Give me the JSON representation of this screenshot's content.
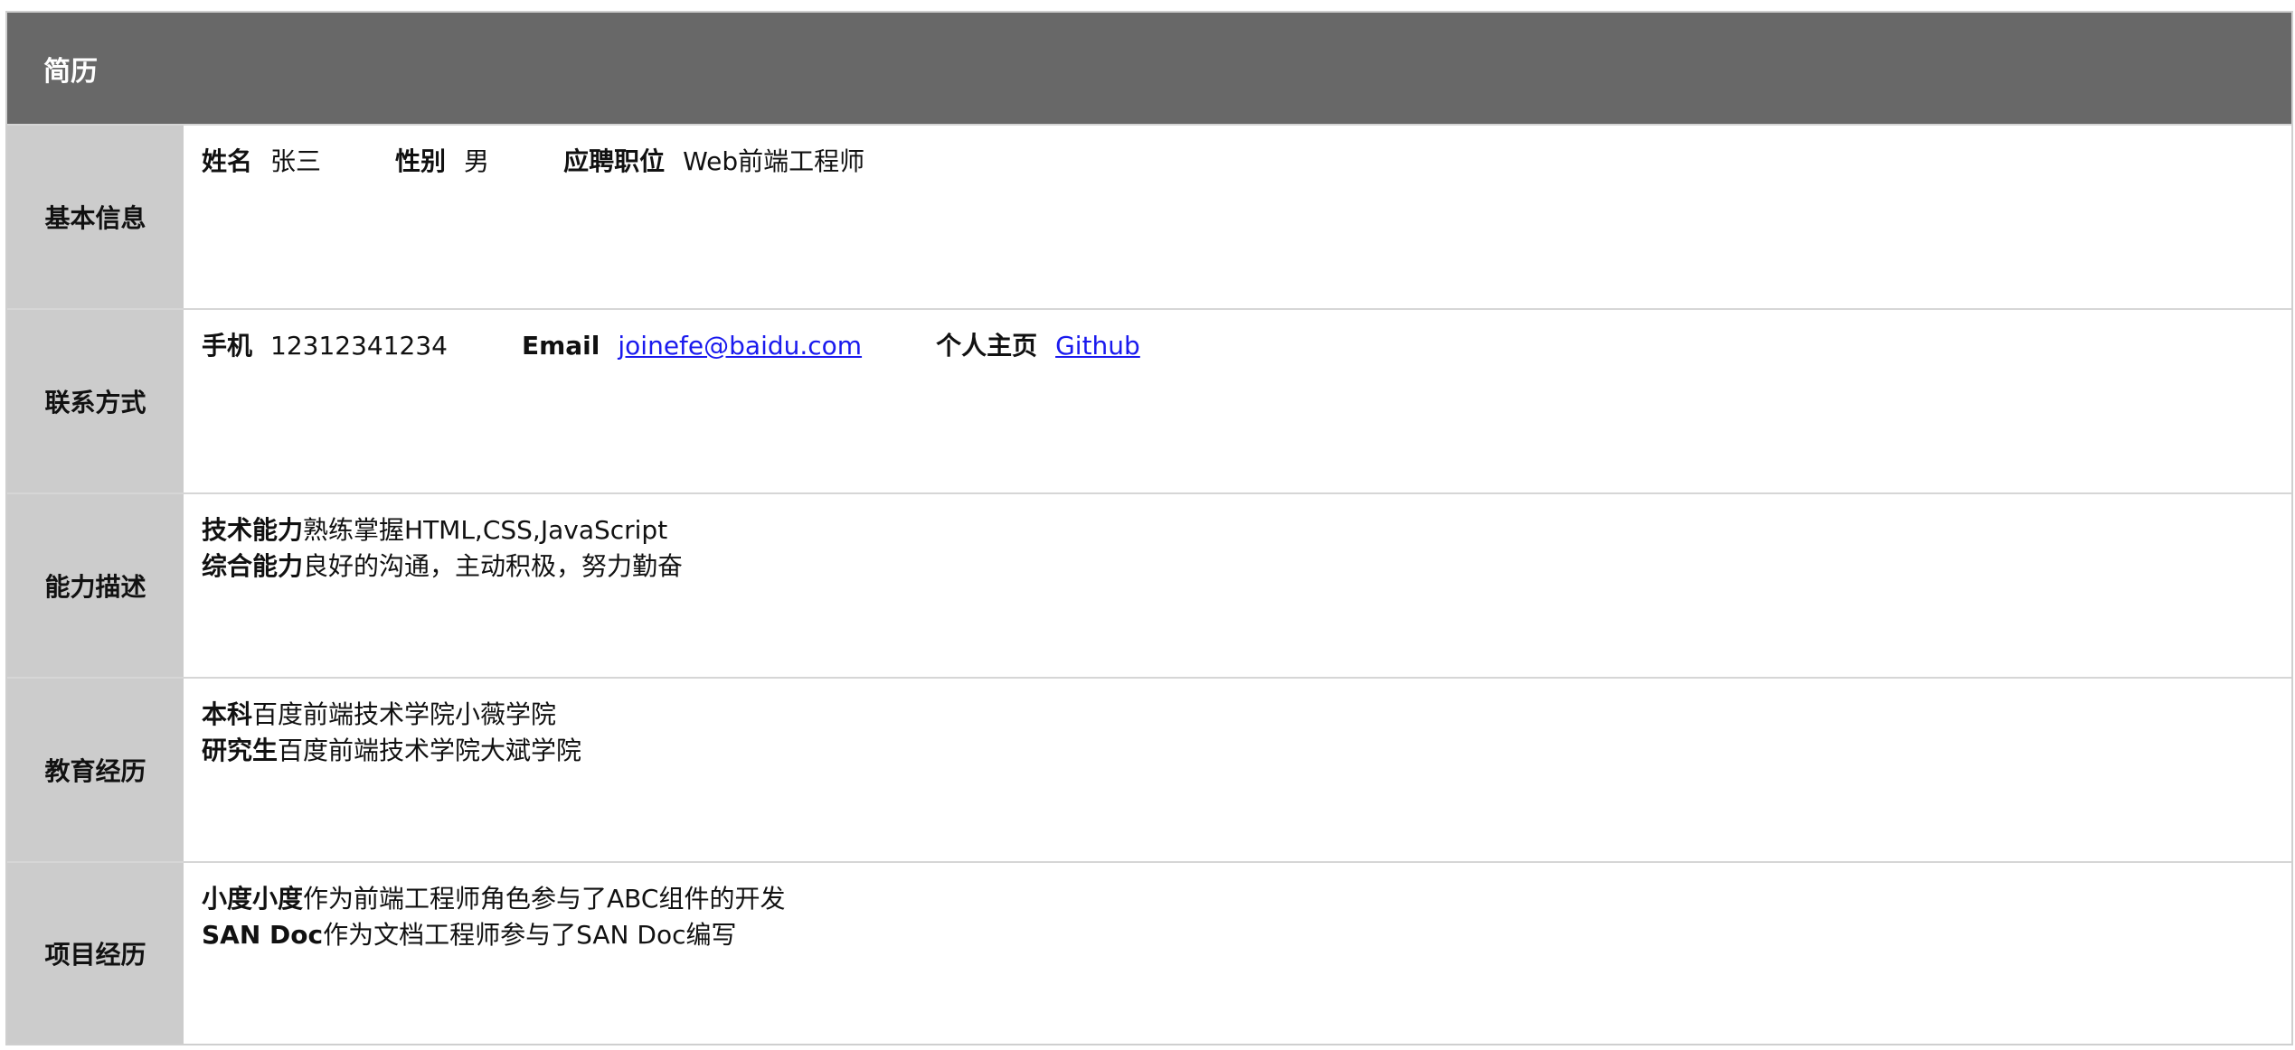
{
  "header": {
    "title": "简历"
  },
  "sections": {
    "basic": {
      "label": "基本信息",
      "name_label": "姓名",
      "name": "张三",
      "gender_label": "性别",
      "gender": "男",
      "position_label": "应聘职位",
      "position": "Web前端工程师"
    },
    "contact": {
      "label": "联系方式",
      "phone_label": "手机",
      "phone": "12312341234",
      "email_label": "Email",
      "email": "joinefe@baidu.com",
      "homepage_label": "个人主页",
      "homepage": "Github"
    },
    "ability": {
      "label": "能力描述",
      "items": [
        {
          "title": "技术能力",
          "text": "熟练掌握HTML,CSS,JavaScript"
        },
        {
          "title": "综合能力",
          "text": "良好的沟通，主动积极，努力勤奋"
        }
      ]
    },
    "education": {
      "label": "教育经历",
      "items": [
        {
          "title": "本科",
          "text": "百度前端技术学院小薇学院"
        },
        {
          "title": "研究生",
          "text": "百度前端技术学院大斌学院"
        }
      ]
    },
    "projects": {
      "label": "项目经历",
      "items": [
        {
          "title": "小度小度",
          "text": "作为前端工程师角色参与了ABC组件的开发"
        },
        {
          "title": "SAN Doc",
          "text": "作为文档工程师参与了SAN Doc编写"
        }
      ]
    }
  },
  "colors": {
    "header_bg": "#686868",
    "label_bg": "#cccccc",
    "link": "#1a1aee"
  }
}
